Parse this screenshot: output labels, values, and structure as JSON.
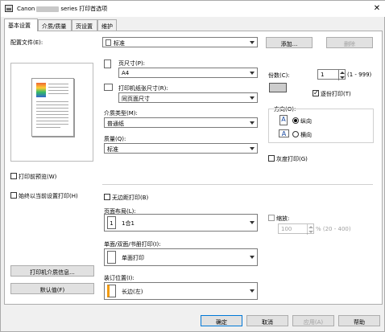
{
  "window": {
    "title_prefix": "Canon",
    "title_suffix": "series 打印首选项",
    "close": "✕"
  },
  "tabs": [
    {
      "label": "基本设置"
    },
    {
      "label": "介质/质量"
    },
    {
      "label": "页设置"
    },
    {
      "label": "维护"
    }
  ],
  "profile": {
    "label": "配置文件(E):",
    "value": "标准",
    "add_button": "添加...",
    "delete_button": "删除"
  },
  "page_size": {
    "label": "页尺寸(P):",
    "value": "A4"
  },
  "printer_paper_size": {
    "label": "打印机纸张尺寸(R):",
    "value": "同页面尺寸"
  },
  "media_type": {
    "label": "介质类型(M):",
    "value": "普通纸"
  },
  "quality": {
    "label": "质量(Q):",
    "value": "标准"
  },
  "copies": {
    "label": "份数(C):",
    "value": "1",
    "range": "(1 - 999)",
    "collate_label": "逐份打印(T)",
    "collate_checked": true
  },
  "orientation": {
    "label": "方向(O):",
    "portrait": "纵向",
    "landscape": "横向",
    "selected": "portrait",
    "icon_letter": "A"
  },
  "grayscale": {
    "label": "灰度打印(G)"
  },
  "preview_before_print": {
    "label": "打印前预览(W)"
  },
  "always_print_current": {
    "label": "始终以当前设置打印(H)"
  },
  "borderless": {
    "label": "无边距打印(B)"
  },
  "page_layout": {
    "label": "页面布局(L):",
    "value": "1合1"
  },
  "scaling": {
    "label": "缩放:",
    "value": "100",
    "unit": "% (20 - 400)"
  },
  "duplex": {
    "label": "单面/双面/书册打印(I):",
    "value": "单面打印"
  },
  "binding": {
    "label": "装订位置(I):",
    "value": "长边(左)"
  },
  "print_media_info_button": "打印机介质信息...",
  "defaults_button": "默认值(F)",
  "footer": {
    "ok": "确定",
    "cancel": "取消",
    "apply": "应用(A)",
    "help": "帮助"
  }
}
